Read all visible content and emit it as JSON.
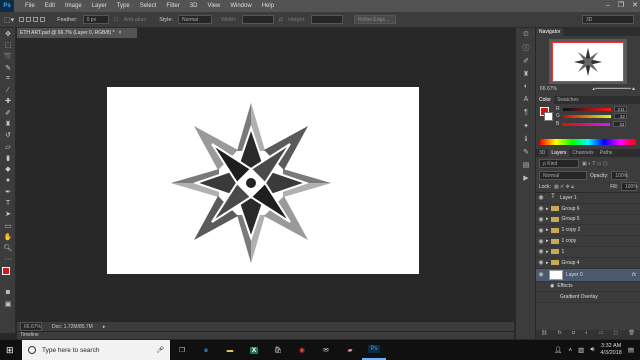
{
  "menu": {
    "logo": "Ps",
    "items": [
      "File",
      "Edit",
      "Image",
      "Layer",
      "Type",
      "Select",
      "Filter",
      "3D",
      "View",
      "Window",
      "Help"
    ],
    "window_controls": [
      "–",
      "❐",
      "✕"
    ]
  },
  "options": {
    "feather_label": "Feather:",
    "feather_value": "0 px",
    "antialias_label": "Anti-alias",
    "style_label": "Style:",
    "style_value": "Normal",
    "width_label": "Width:",
    "height_label": "Height:",
    "refine_label": "Refine Edge...",
    "workspace": "3D"
  },
  "document": {
    "tab_title": "ETH ART.psd @ 66.7% (Layer 0, RGB/8) *",
    "close": "×"
  },
  "status": {
    "zoom": "66.67%",
    "doc": "Doc: 1.72M/85.7M"
  },
  "timeline": {
    "label": "Timeline"
  },
  "navigator": {
    "tab": "Navigator",
    "zoom": "66.67%"
  },
  "color": {
    "tabs": [
      "Color",
      "Swatches"
    ],
    "r": "211",
    "g": "22",
    "b": "22",
    "fg_color": "#d31616"
  },
  "layers": {
    "tabs": [
      "3D",
      "Layers",
      "Channels",
      "Paths"
    ],
    "kind": "ρ Kind",
    "blend": "Normal",
    "opacity_label": "Opacity:",
    "opacity": "100%",
    "lock_label": "Lock:",
    "fill_label": "Fill:",
    "fill": "100%",
    "rows": [
      {
        "name": "Layer 1",
        "type": "text"
      },
      {
        "name": "Group 6",
        "type": "group"
      },
      {
        "name": "Group 5",
        "type": "group"
      },
      {
        "name": "1 copy 2",
        "type": "group"
      },
      {
        "name": "1 copy",
        "type": "group"
      },
      {
        "name": "1",
        "type": "group"
      },
      {
        "name": "Group 4",
        "type": "group"
      },
      {
        "name": "Layer 0",
        "type": "layer",
        "fx": "fx"
      }
    ],
    "effects_label": "Effects",
    "effect_item": "Gradient Overlay"
  },
  "taskbar": {
    "search_placeholder": "Type here to search",
    "time": "3:32 AM",
    "date": "4/3/2018"
  }
}
